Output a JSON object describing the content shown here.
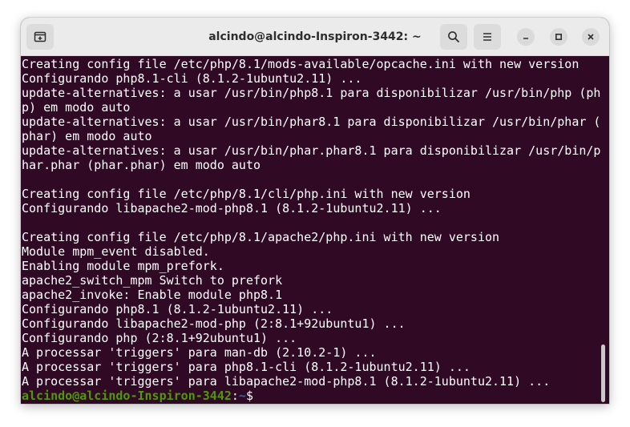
{
  "window": {
    "title": "alcindo@alcindo-Inspiron-3442: ~"
  },
  "titlebar": {
    "new_tab_icon": "new-tab-icon",
    "search_icon": "search-icon",
    "menu_icon": "hamburger-menu-icon",
    "minimize_icon": "minimize-icon",
    "maximize_icon": "maximize-icon",
    "close_icon": "close-icon"
  },
  "terminal": {
    "lines": [
      "Creating config file /etc/php/8.1/mods-available/opcache.ini with new version",
      "Configurando php8.1-cli (8.1.2-1ubuntu2.11) ...",
      "update-alternatives: a usar /usr/bin/php8.1 para disponibilizar /usr/bin/php (ph",
      "p) em modo auto",
      "update-alternatives: a usar /usr/bin/phar8.1 para disponibilizar /usr/bin/phar (",
      "phar) em modo auto",
      "update-alternatives: a usar /usr/bin/phar.phar8.1 para disponibilizar /usr/bin/p",
      "har.phar (phar.phar) em modo auto",
      "",
      "Creating config file /etc/php/8.1/cli/php.ini with new version",
      "Configurando libapache2-mod-php8.1 (8.1.2-1ubuntu2.11) ...",
      "",
      "Creating config file /etc/php/8.1/apache2/php.ini with new version",
      "Module mpm_event disabled.",
      "Enabling module mpm_prefork.",
      "apache2_switch_mpm Switch to prefork",
      "apache2_invoke: Enable module php8.1",
      "Configurando php8.1 (8.1.2-1ubuntu2.11) ...",
      "Configurando libapache2-mod-php (2:8.1+92ubuntu1) ...",
      "Configurando php (2:8.1+92ubuntu1) ...",
      "A processar 'triggers' para man-db (2.10.2-1) ...",
      "A processar 'triggers' para php8.1-cli (8.1.2-1ubuntu2.11) ...",
      "A processar 'triggers' para libapache2-mod-php8.1 (8.1.2-1ubuntu2.11) ..."
    ],
    "prompt": {
      "user_host": "alcindo@alcindo-Inspiron-3442",
      "separator": ":",
      "path": "~",
      "symbol": "$"
    }
  },
  "colors": {
    "terminal_bg": "#300a24",
    "terminal_fg": "#ffffff",
    "prompt_user": "#4e9a06",
    "prompt_path": "#3465a4",
    "titlebar_bg": "#ebebeb"
  }
}
